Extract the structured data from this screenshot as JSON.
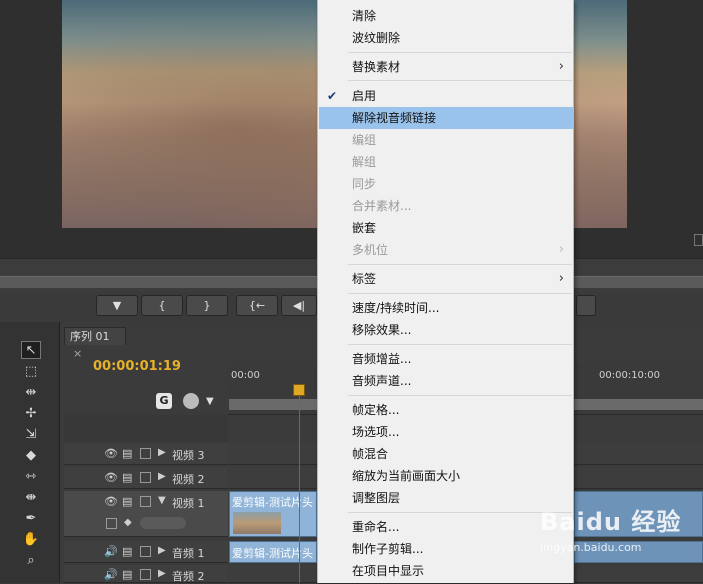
{
  "sequence_tab": {
    "label": "序列 01",
    "close": "×"
  },
  "timeline": {
    "timecode": "00:00:01:19",
    "ruler": [
      "00:00",
      "00:00:10:00"
    ],
    "tracks": [
      {
        "label": "视频 3"
      },
      {
        "label": "视频 2"
      },
      {
        "label": "视频 1"
      },
      {
        "label": "音频 1"
      },
      {
        "label": "音频 2"
      }
    ],
    "clips": {
      "video1": "爱剪辑-测试片头",
      "audio1": "爱剪辑-测试片头"
    }
  },
  "transport": {
    "buttons": [
      "▼",
      "{",
      "}",
      "{←",
      "◀|"
    ]
  },
  "menu": {
    "items": [
      {
        "label": "清除",
        "state": "enabled"
      },
      {
        "label": "波纹删除",
        "state": "enabled"
      },
      {
        "label": "替换素材",
        "state": "enabled",
        "submenu": "›"
      },
      {
        "label": "启用",
        "state": "enabled",
        "check": "✔"
      },
      {
        "label": "解除视音频链接",
        "state": "highlighted"
      },
      {
        "label": "编组",
        "state": "disabled"
      },
      {
        "label": "解组",
        "state": "disabled"
      },
      {
        "label": "同步",
        "state": "disabled"
      },
      {
        "label": "合并素材...",
        "state": "disabled"
      },
      {
        "label": "嵌套",
        "state": "enabled"
      },
      {
        "label": "多机位",
        "state": "disabled",
        "submenu": "›"
      },
      {
        "label": "标签",
        "state": "enabled",
        "submenu": "›"
      },
      {
        "label": "速度/持续时间...",
        "state": "enabled"
      },
      {
        "label": "移除效果...",
        "state": "enabled"
      },
      {
        "label": "音频增益...",
        "state": "enabled"
      },
      {
        "label": "音频声道...",
        "state": "enabled"
      },
      {
        "label": "帧定格...",
        "state": "enabled"
      },
      {
        "label": "场选项...",
        "state": "enabled"
      },
      {
        "label": "帧混合",
        "state": "enabled"
      },
      {
        "label": "缩放为当前画面大小",
        "state": "enabled"
      },
      {
        "label": "调整图层",
        "state": "enabled"
      },
      {
        "label": "重命名...",
        "state": "enabled"
      },
      {
        "label": "制作子剪辑...",
        "state": "enabled"
      },
      {
        "label": "在项目中显示",
        "state": "enabled"
      }
    ]
  },
  "watermark": {
    "brand": "Baidu 经验",
    "url": "jingyan.baidu.com"
  }
}
